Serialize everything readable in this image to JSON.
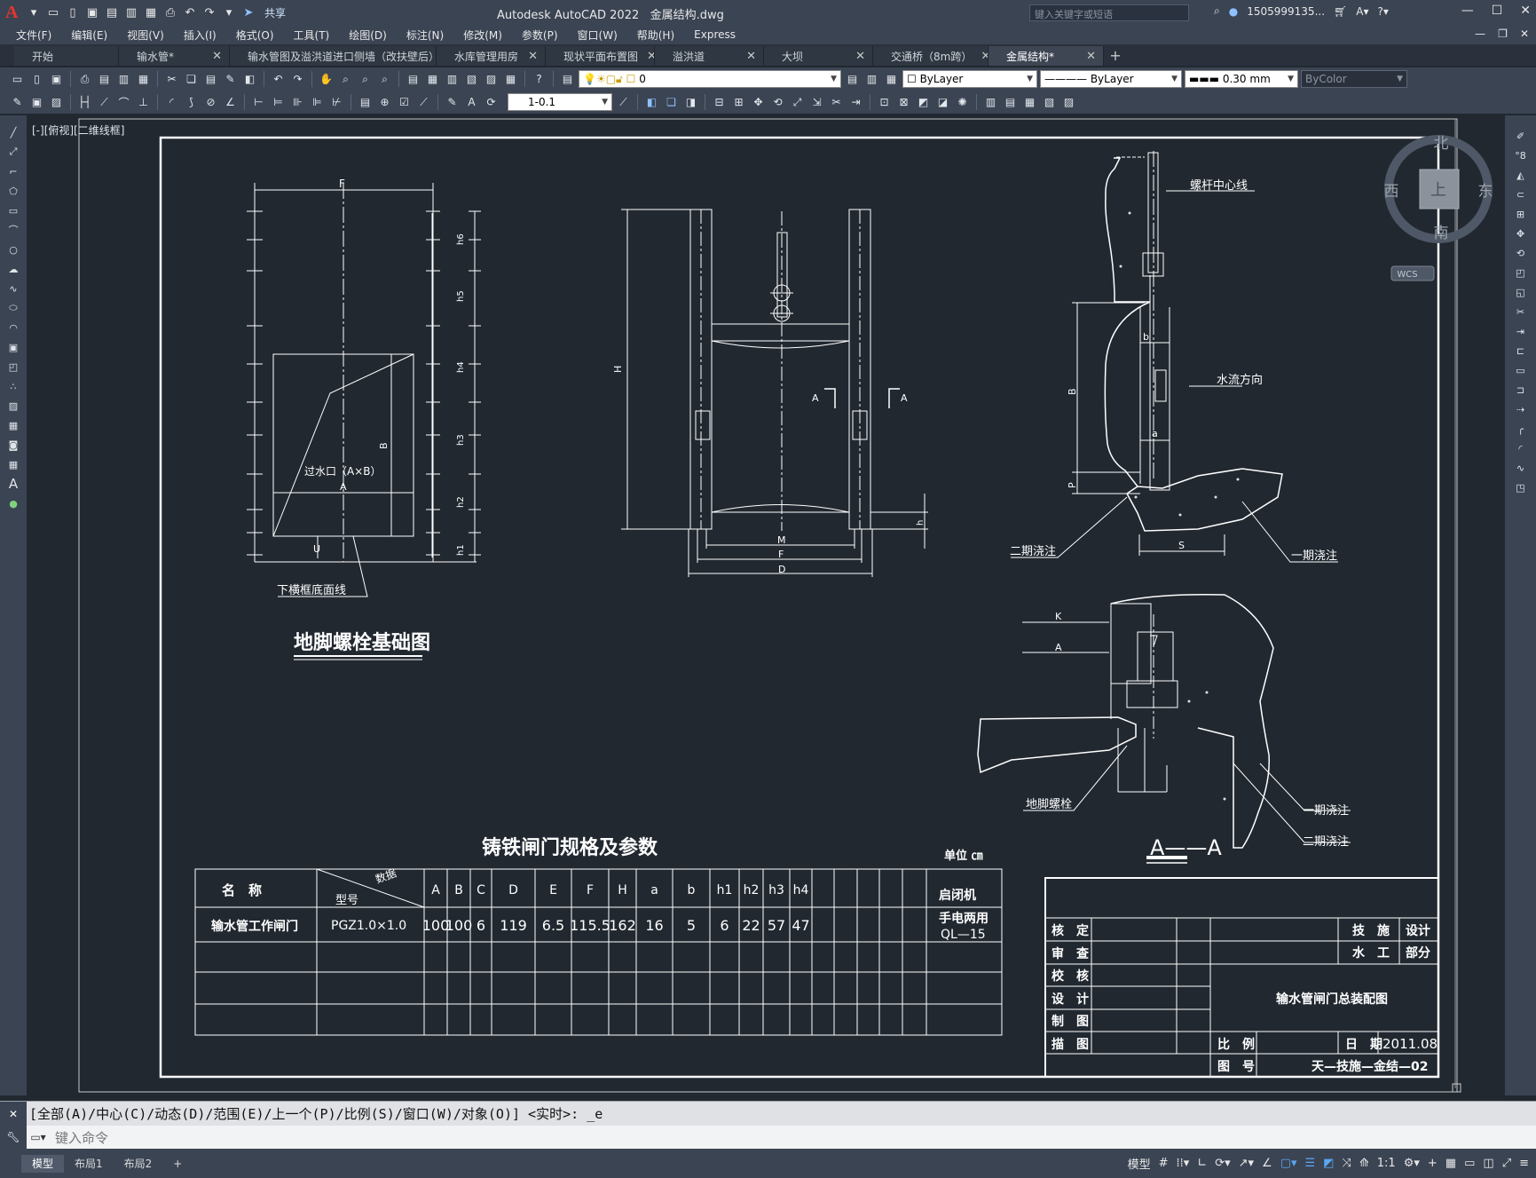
{
  "app": {
    "title": "Autodesk AutoCAD 2022",
    "filename": "金属结构.dwg",
    "share_label": "共享",
    "search_placeholder": "键入关键字或短语",
    "user": "1505999135...",
    "logo": "A"
  },
  "menu": [
    "文件(F)",
    "编辑(E)",
    "视图(V)",
    "插入(I)",
    "格式(O)",
    "工具(T)",
    "绘图(D)",
    "标注(N)",
    "修改(M)",
    "参数(P)",
    "窗口(W)",
    "帮助(H)",
    "Express"
  ],
  "tabs": [
    {
      "label": "开始",
      "close": false,
      "width": 118
    },
    {
      "label": "输水管*",
      "close": true,
      "width": 125
    },
    {
      "label": "输水管图及溢洪道进口侧墙（改扶壁后）",
      "close": true,
      "width": 233
    },
    {
      "label": "水库管理用房",
      "close": true,
      "width": 123
    },
    {
      "label": "现状平面布置图",
      "close": true,
      "width": 123
    },
    {
      "label": "溢洪道",
      "close": true,
      "width": 123
    },
    {
      "label": "大坝",
      "close": true,
      "width": 123
    },
    {
      "label": "交通桥（8m跨）",
      "close": true,
      "width": 130
    },
    {
      "label": "金属结构*",
      "close": true,
      "width": 130,
      "active": true
    }
  ],
  "toolbar": {
    "layer_value": "0",
    "color_value": "ByLayer",
    "linetype_value": "ByLayer",
    "lineweight_value": "0.30 mm",
    "plotstyle_value": "ByColor",
    "dimstyle_value": "1-0.1"
  },
  "viewport_label": "[-][俯视][二维线框]",
  "viewcube": {
    "north": "北",
    "south": "南",
    "east": "东",
    "west": "西",
    "top": "上",
    "wcs": "WCS"
  },
  "drawing": {
    "title_left": "地脚螺栓基础图",
    "table_title": "铸铁闸门规格及参数",
    "unit_label": "单位 ㎝",
    "section_label": "A——A",
    "labels": {
      "overflow": "过水口（A×B）",
      "lower_frame": "下横框底面线",
      "screw_center": "螺杆中心线",
      "flow_dir": "水流方向",
      "second_pour_1": "二期浇注",
      "first_pour_1": "一期浇注",
      "anchor_bolt": "地脚螺栓",
      "first_pour_2": "一期浇注",
      "second_pour_2": "二期浇注"
    },
    "table_headers": [
      "名　称",
      "型号",
      "数据",
      "A",
      "B",
      "C",
      "D",
      "E",
      "F",
      "H",
      "a",
      "b",
      "h1",
      "h2",
      "h3",
      "h4",
      "启闭机"
    ],
    "table_row": [
      "输水管工作闸门",
      "PGZ1.0×1.0",
      "100",
      "100",
      "6",
      "119",
      "6.5",
      "115.5",
      "162",
      "16",
      "5",
      "6",
      "22",
      "57",
      "47",
      "手电两用",
      "QL—15"
    ],
    "titleblock": {
      "rows": [
        "核　定",
        "审　查",
        "校　核",
        "设　计",
        "制　图",
        "描　图"
      ],
      "tech": "技　施",
      "design": "设计",
      "water": "水　工",
      "part": "部分",
      "drawing_name": "输水管闸门总装配图",
      "scale_label": "比　例",
      "date_label": "日　期",
      "date_value": "2011.08",
      "no_label": "图　号",
      "no_value": "天—技施—金结—02"
    }
  },
  "command": {
    "history": "[全部(A)/中心(C)/动态(D)/范围(E)/上一个(P)/比例(S)/窗口(W)/对象(O)] <实时>: _e",
    "placeholder": "键入命令"
  },
  "layouts": [
    "模型",
    "布局1",
    "布局2"
  ],
  "status": {
    "model": "模型",
    "scale": "1:1"
  },
  "colors": {
    "bg": "#212830",
    "ui": "#3b4453",
    "line": "#ffffff",
    "logo": "#e8352e"
  }
}
